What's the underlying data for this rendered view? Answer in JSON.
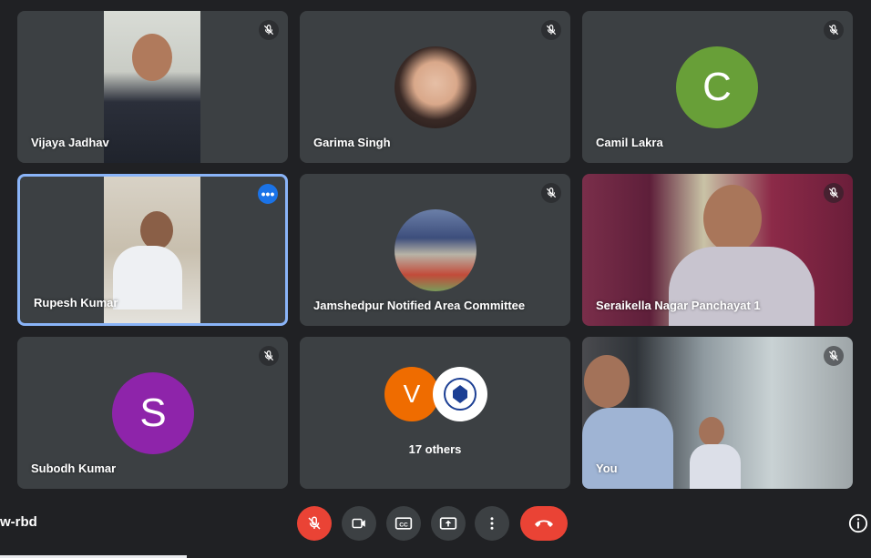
{
  "participants": [
    {
      "name": "Vijaya Jadhav",
      "muted": true,
      "type": "video"
    },
    {
      "name": "Garima Singh",
      "muted": true,
      "type": "photo"
    },
    {
      "name": "Camil Lakra",
      "muted": true,
      "type": "letter",
      "letter": "C",
      "color": "#689f38"
    },
    {
      "name": "Rupesh Kumar",
      "muted": false,
      "type": "video",
      "active": true
    },
    {
      "name": "Jamshedpur Notified Area Committee",
      "muted": true,
      "type": "photo"
    },
    {
      "name": "Seraikella Nagar Panchayat 1",
      "muted": true,
      "type": "video"
    },
    {
      "name": "Subodh Kumar",
      "muted": true,
      "type": "letter",
      "letter": "S",
      "color": "#8e24aa"
    },
    {
      "name": "17 others",
      "type": "group",
      "letter": "V",
      "color": "#ef6c00"
    },
    {
      "name": "You",
      "muted": true,
      "type": "video"
    }
  ],
  "meeting": {
    "code": "w-rbd"
  },
  "controls": {
    "mic_icon": "mic-off-icon",
    "camera_icon": "videocam-icon",
    "captions_icon": "closed-captions-icon",
    "present_icon": "present-screen-icon",
    "more_icon": "more-vert-icon",
    "end_call_icon": "call-end-icon",
    "info_icon": "info-icon"
  },
  "colors": {
    "background": "#202124",
    "tile": "#3c4043",
    "red": "#ea4335",
    "active_border": "#8ab4f8"
  }
}
